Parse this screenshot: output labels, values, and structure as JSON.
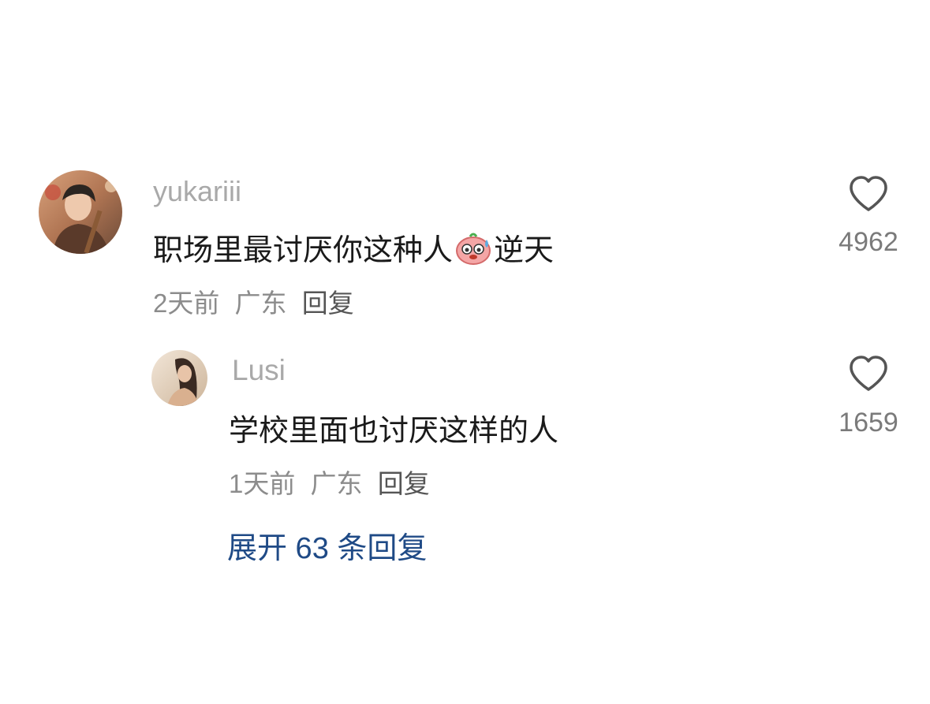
{
  "comments": [
    {
      "username": "yukariii",
      "text_before": "职场里最讨厌你这种人",
      "emoji": "sweat-pig-emoji",
      "text_after": "逆天",
      "time": "2天前",
      "location": "广东",
      "reply_label": "回复",
      "likes": "4962"
    }
  ],
  "replies": [
    {
      "username": "Lusi",
      "text": "学校里面也讨厌这样的人",
      "time": "1天前",
      "location": "广东",
      "reply_label": "回复",
      "likes": "1659"
    }
  ],
  "expand_label": "展开 63 条回复",
  "colors": {
    "username": "#a9a9a9",
    "text": "#1a1a1a",
    "meta": "#8c8c8c",
    "like_count": "#7a7a7a",
    "expand_link": "#1f4a86"
  },
  "icons": [
    "heart-outline-icon",
    "sweat-pig-emoji"
  ]
}
